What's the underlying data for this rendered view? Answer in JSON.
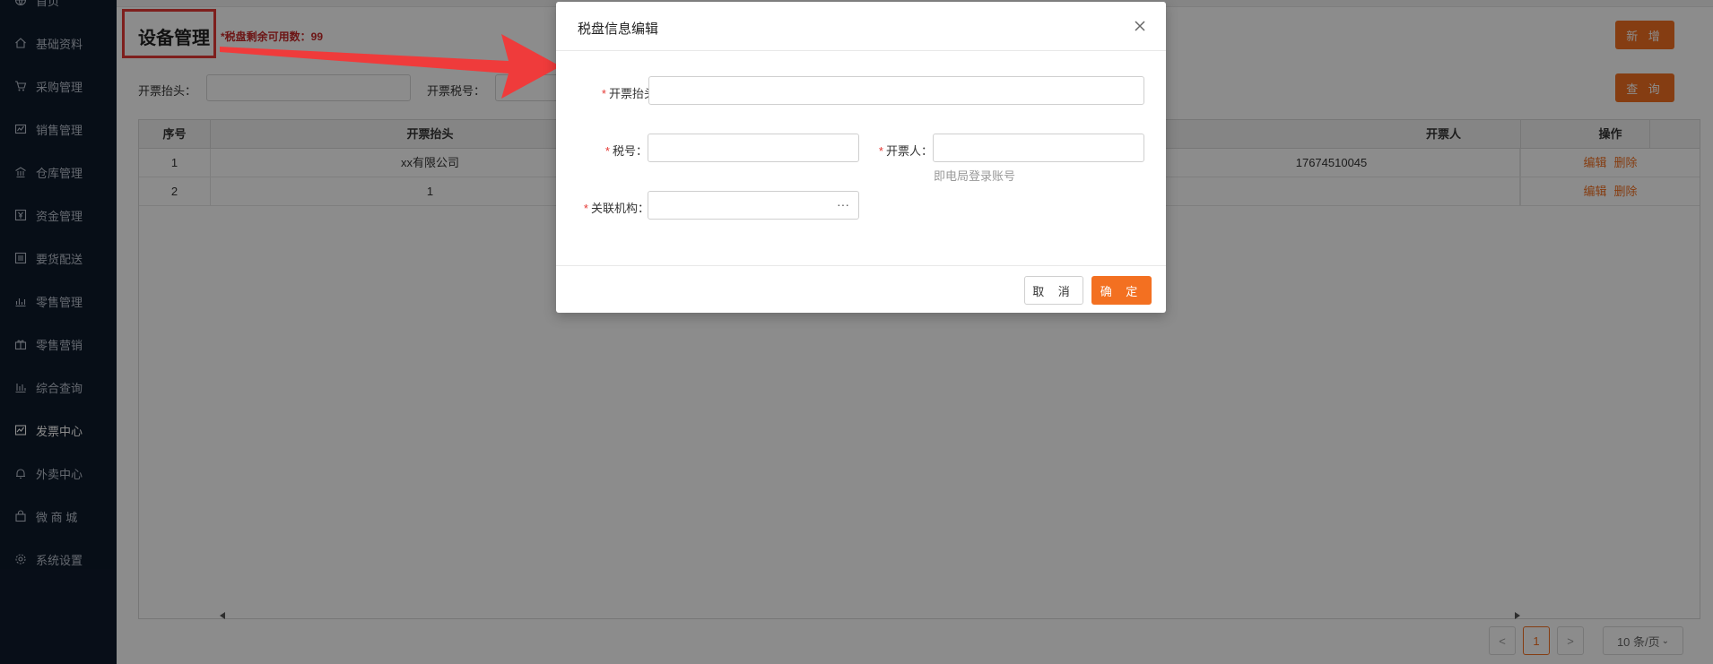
{
  "sidebar": {
    "items": [
      {
        "label": "首页",
        "icon": "globe-icon"
      },
      {
        "label": "基础资料",
        "icon": "home-icon"
      },
      {
        "label": "采购管理",
        "icon": "cart-icon"
      },
      {
        "label": "销售管理",
        "icon": "sales-icon"
      },
      {
        "label": "仓库管理",
        "icon": "warehouse-icon"
      },
      {
        "label": "资金管理",
        "icon": "yuan-icon"
      },
      {
        "label": "要货配送",
        "icon": "list-icon"
      },
      {
        "label": "零售管理",
        "icon": "chart-icon"
      },
      {
        "label": "零售营销",
        "icon": "gift-icon"
      },
      {
        "label": "综合查询",
        "icon": "bar-chart-icon"
      },
      {
        "label": "发票中心",
        "icon": "invoice-icon"
      },
      {
        "label": "外卖中心",
        "icon": "bell-icon"
      },
      {
        "label": "微 商 城",
        "icon": "shop-bag-icon"
      },
      {
        "label": "系统设置",
        "icon": "gear-icon"
      }
    ],
    "active_index": 10
  },
  "page": {
    "title": "设备管理",
    "remain_text": "*税盘剩余可用数：99",
    "add_button": "新 增",
    "query_button": "查 询"
  },
  "filters": {
    "title_label": "开票抬头：",
    "tax_label": "开票税号："
  },
  "table": {
    "columns": [
      "序号",
      "开票抬头",
      "开票人",
      "操作"
    ],
    "rows": [
      {
        "index": "1",
        "title": "xx有限公司",
        "issuer": "17674510045",
        "edit": "编辑",
        "delete": "删除"
      },
      {
        "index": "2",
        "title": "1",
        "issuer": "",
        "edit": "编辑",
        "delete": "删除"
      }
    ]
  },
  "pager": {
    "prev": "<",
    "current": "1",
    "next": ">",
    "page_size": "10 条/页"
  },
  "modal": {
    "title": "税盘信息编辑",
    "fields": {
      "invoice_title_label": "开票抬头：",
      "tax_no_label": "税号：",
      "issuer_label": "开票人：",
      "issuer_hint": "即电局登录账号",
      "org_label": "关联机构："
    },
    "required_mark": "*",
    "org_more": "···",
    "cancel": "取 消",
    "ok": "确 定"
  },
  "colors": {
    "accent": "#f37021",
    "sidebar_bg": "#0e1a2b",
    "highlight": "#e53935"
  }
}
